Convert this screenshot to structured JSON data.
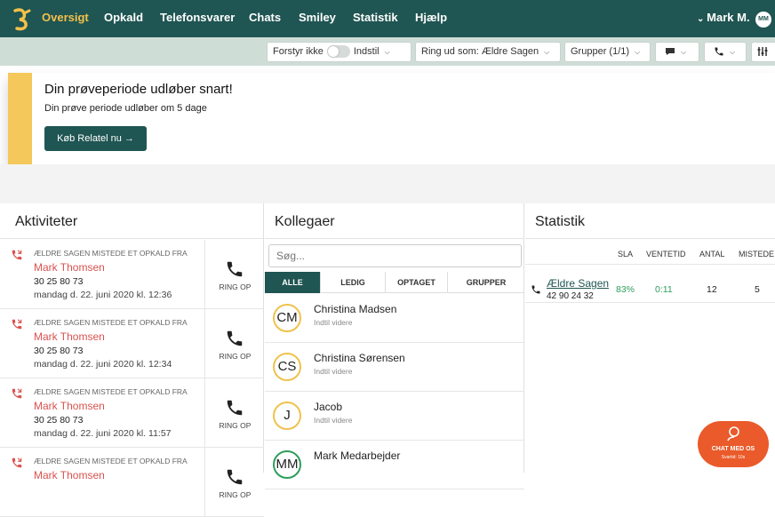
{
  "nav": {
    "items": [
      "Oversigt",
      "Opkald",
      "Telefonsvarer",
      "Chats",
      "Smiley",
      "Statistik",
      "Hjælp"
    ],
    "user_label": "Mark M.",
    "user_initials": "MM"
  },
  "toolbar": {
    "forstyr_label": "Forstyr ikke",
    "indstil_label": "Indstil",
    "ring_ud_label": "Ring ud som: Ældre Sagen",
    "grupper_label": "Grupper (1/1)"
  },
  "banner": {
    "title": "Din prøveperiode udløber snart!",
    "text": "Din prøve periode udløber om 5 dage",
    "button_label": "Køb Relatel nu →"
  },
  "activities": {
    "title": "Aktiviteter",
    "ring_label": "RING OP",
    "items": [
      {
        "label": "ÆLDRE SAGEN MISTEDE ET OPKALD FRA",
        "name": "Mark Thomsen",
        "phone": "30 25 80 73",
        "date": "mandag d. 22. juni 2020 kl. 12:36"
      },
      {
        "label": "ÆLDRE SAGEN MISTEDE ET OPKALD FRA",
        "name": "Mark Thomsen",
        "phone": "30 25 80 73",
        "date": "mandag d. 22. juni 2020 kl. 12:34"
      },
      {
        "label": "ÆLDRE SAGEN MISTEDE ET OPKALD FRA",
        "name": "Mark Thomsen",
        "phone": "30 25 80 73",
        "date": "mandag d. 22. juni 2020 kl. 11:57"
      },
      {
        "label": "ÆLDRE SAGEN MISTEDE ET OPKALD FRA",
        "name": "Mark Thomsen",
        "phone": "",
        "date": ""
      }
    ]
  },
  "colleagues": {
    "title": "Kollegaer",
    "search_placeholder": "Søg...",
    "tabs": [
      "ALLE",
      "LEDIG",
      "OPTAGET",
      "GRUPPER"
    ],
    "items": [
      {
        "initials": "CM",
        "name": "Christina Madsen",
        "status": "Indtil videre"
      },
      {
        "initials": "CS",
        "name": "Christina Sørensen",
        "status": "Indtil videre"
      },
      {
        "initials": "J",
        "name": "Jacob",
        "status": "Indtil videre"
      },
      {
        "initials": "MM",
        "name": "Mark Medarbejder",
        "status": ""
      }
    ]
  },
  "statistics": {
    "title": "Statistik",
    "headers": [
      "SLA",
      "VENTETID",
      "ANTAL",
      "MISTEDE"
    ],
    "row": {
      "name": "Ældre Sagen",
      "phone": "42 90 24 32",
      "sla": "83%",
      "ventetid": "0:11",
      "antal": "12",
      "mistede": "5"
    }
  },
  "chat": {
    "label": "CHAT MED OS",
    "sub": "Svartid: 10s"
  },
  "colors": {
    "brand": "#1f5552",
    "accent": "#f3c14b",
    "missed": "#d9534f",
    "chat": "#ea5a2a"
  }
}
